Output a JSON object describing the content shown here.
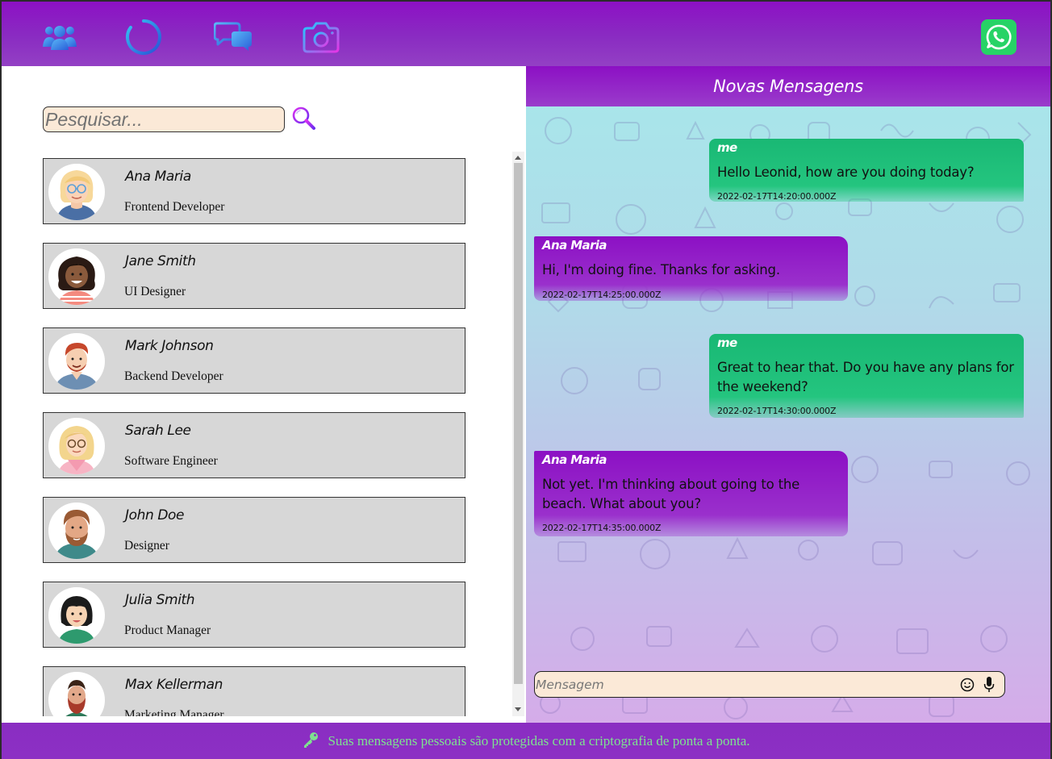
{
  "nav": {
    "items": [
      {
        "icon": "users-icon"
      },
      {
        "icon": "status-ring-icon"
      },
      {
        "icon": "chat-bubbles-icon"
      },
      {
        "icon": "camera-icon"
      }
    ],
    "brand_icon": "whatsapp-icon",
    "colors": {
      "bar": "#8c10c4",
      "icon_gradient_start": "#4aa8f5",
      "icon_gradient_end": "#2a5ed8"
    }
  },
  "search": {
    "placeholder": "Pesquisar...",
    "value": "",
    "button_icon": "search-icon"
  },
  "contacts": [
    {
      "name": "Ana Maria",
      "role": "Frontend Developer"
    },
    {
      "name": "Jane Smith",
      "role": "UI Designer"
    },
    {
      "name": "Mark Johnson",
      "role": "Backend Developer"
    },
    {
      "name": "Sarah Lee",
      "role": "Software Engineer"
    },
    {
      "name": "John Doe",
      "role": "Designer"
    },
    {
      "name": "Julia Smith",
      "role": "Product Manager"
    },
    {
      "name": "Max Kellerman",
      "role": "Marketing Manager"
    }
  ],
  "chat": {
    "title": "Novas Mensagens",
    "messages": [
      {
        "sender": "me",
        "text": "Hello Leonid, how are you doing today?",
        "time": "2022-02-17T14:20:00.000Z",
        "from_me": true
      },
      {
        "sender": "Ana Maria",
        "text": "Hi, I'm doing fine. Thanks for asking.",
        "time": "2022-02-17T14:25:00.000Z",
        "from_me": false
      },
      {
        "sender": "me",
        "text": "Great to hear that. Do you have any plans for the weekend?",
        "time": "2022-02-17T14:30:00.000Z",
        "from_me": true
      },
      {
        "sender": "Ana Maria",
        "text": "Not yet. I'm thinking about going to the beach. What about you?",
        "time": "2022-02-17T14:35:00.000Z",
        "from_me": false
      }
    ],
    "input": {
      "placeholder": "Mensagem",
      "value": ""
    },
    "colors": {
      "me_bubble": "#19b874",
      "them_bubble": "#8c10c4"
    }
  },
  "footer": {
    "text": "Suas mensagens pessoais são protegidas com a criptografia de ponta a ponta.",
    "icon": "key-icon",
    "text_color": "#7ee28f"
  }
}
